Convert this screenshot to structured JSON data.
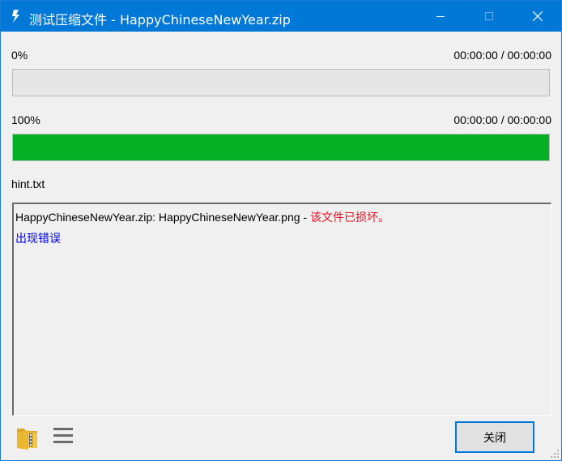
{
  "window": {
    "title": "测试压缩文件 - HappyChineseNewYear.zip"
  },
  "titlebar_buttons": {
    "minimize_icon": "minimize-icon",
    "maximize_icon": "maximize-icon",
    "close_icon": "close-icon"
  },
  "progress_1": {
    "percent_label": "0%",
    "time_label": "00:00:00 / 00:00:00",
    "fraction": 0
  },
  "progress_2": {
    "percent_label": "100%",
    "time_label": "00:00:00 / 00:00:00",
    "fraction": 1.0
  },
  "current_file": "hint.txt",
  "log": {
    "line1_prefix": "HappyChineseNewYear.zip: HappyChineseNewYear.png - ",
    "line1_error": "该文件已损坏。",
    "line2": "出现错误"
  },
  "footer": {
    "folder_icon": "folder-zip-icon",
    "menu_icon": "hamburger-menu-icon",
    "close_label": "关闭"
  },
  "colors": {
    "titlebar": "#0078d7",
    "progress_fill": "#06b025",
    "error_text": "#e81123",
    "info_text": "#0000ee"
  }
}
